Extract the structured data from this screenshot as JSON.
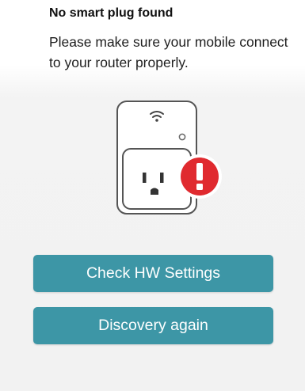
{
  "status": {
    "title": "No smart plug found",
    "message": "Please make sure your mobile connect to your router properly."
  },
  "illustration": {
    "device": "smart-plug",
    "status_icon": "exclamation-icon",
    "alert_color": "#e02a2f"
  },
  "actions": {
    "check_hw_label": "Check HW Settings",
    "discovery_label": "Discovery again"
  },
  "theme": {
    "button_color": "#3d96a6",
    "background": "#f2f2f2"
  }
}
